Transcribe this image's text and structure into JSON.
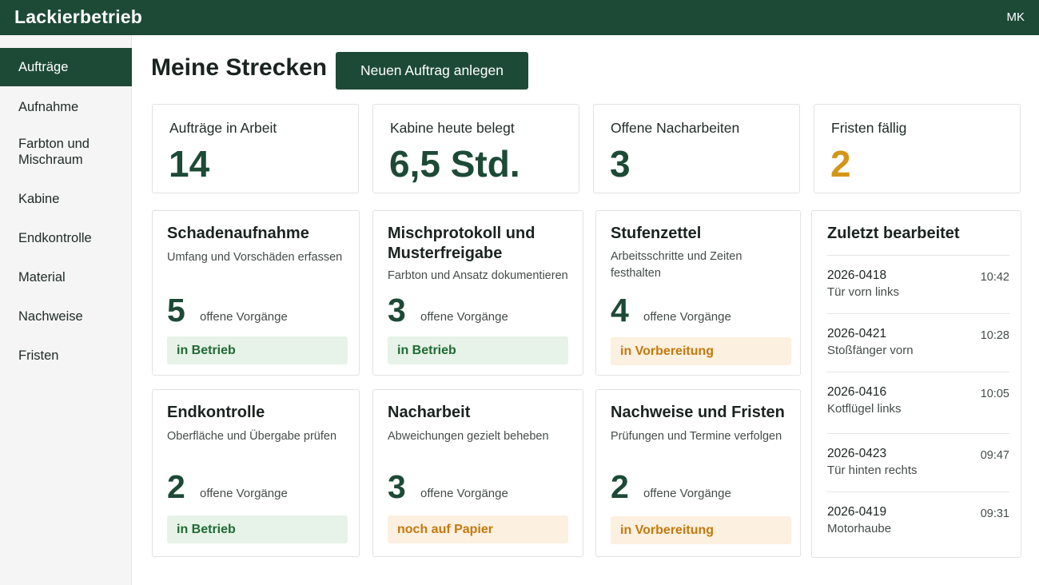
{
  "app": {
    "title": "Lackierbetrieb",
    "user_initials": "MK"
  },
  "sidebar": {
    "items": [
      {
        "label": "Aufträge"
      },
      {
        "label": "Aufnahme"
      },
      {
        "label": "Farbton und Mischraum"
      },
      {
        "label": "Kabine"
      },
      {
        "label": "Endkontrolle"
      },
      {
        "label": "Material"
      },
      {
        "label": "Nachweise"
      },
      {
        "label": "Fristen"
      }
    ]
  },
  "main": {
    "title": "Meine Strecken",
    "new_order_label": "Neuen Auftrag anlegen"
  },
  "stats": [
    {
      "label": "Aufträge in Arbeit",
      "value": "14"
    },
    {
      "label": "Kabine heute belegt",
      "value": "6,5 Std."
    },
    {
      "label": "Offene Nacharbeiten",
      "value": "3"
    },
    {
      "label": "Fristen fällig",
      "value": "2"
    }
  ],
  "modules": [
    {
      "title": "Schadenaufnahme",
      "subtitle": "Umfang und Vorschäden erfassen",
      "count": "5",
      "count_label": "offene Vorgänge",
      "status": "in Betrieb"
    },
    {
      "title": "Mischprotokoll und Musterfreigabe",
      "subtitle": "Farbton und Ansatz dokumentieren",
      "count": "3",
      "count_label": "offene Vorgänge",
      "status": "in Betrieb"
    },
    {
      "title": "Stufenzettel",
      "subtitle": "Arbeitsschritte und Zeiten festhalten",
      "count": "4",
      "count_label": "offene Vorgänge",
      "status": "in Vorbereitung"
    },
    {
      "title": "Endkontrolle",
      "subtitle": "Oberfläche und Übergabe prüfen",
      "count": "2",
      "count_label": "offene Vorgänge",
      "status": "in Betrieb"
    },
    {
      "title": "Nacharbeit",
      "subtitle": "Abweichungen gezielt beheben",
      "count": "3",
      "count_label": "offene Vorgänge",
      "status": "noch auf Papier"
    },
    {
      "title": "Nachweise und Fristen",
      "subtitle": "Prüfungen und Termine verfolgen",
      "count": "2",
      "count_label": "offene Vorgänge",
      "status": "in Vorbereitung"
    }
  ],
  "recent": {
    "title": "Zuletzt bearbeitet",
    "items": [
      {
        "id": "2026-0418",
        "name": "Tür vorn links",
        "time": "10:42"
      },
      {
        "id": "2026-0421",
        "name": "Stoßfänger vorn",
        "time": "10:28"
      },
      {
        "id": "2026-0416",
        "name": "Kotflügel links",
        "time": "10:05"
      },
      {
        "id": "2026-0423",
        "name": "Tür hinten rechts",
        "time": "09:47"
      },
      {
        "id": "2026-0419",
        "name": "Motorhaube",
        "time": "09:31"
      }
    ]
  },
  "colors": {
    "brand": "#1d4a37",
    "status_active": "#1e6a33",
    "status_pending": "#c6780c",
    "warning_value": "#d4961a"
  }
}
